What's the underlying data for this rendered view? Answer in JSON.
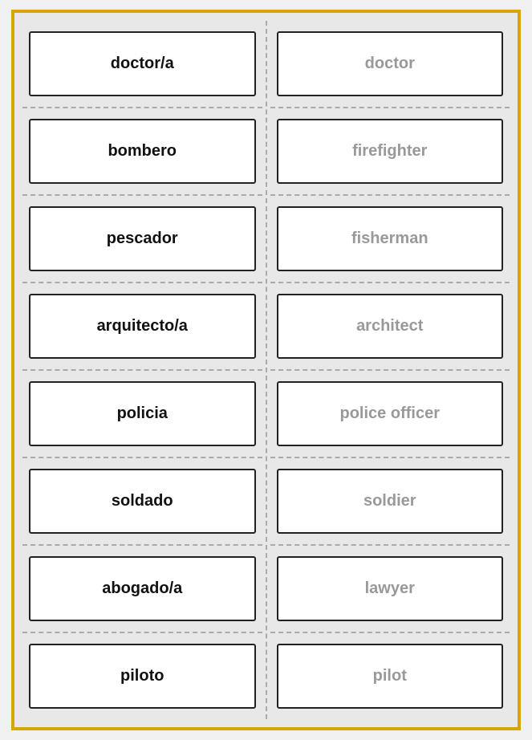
{
  "rows": [
    {
      "spanish": "doctor/a",
      "english": "doctor"
    },
    {
      "spanish": "bombero",
      "english": "firefighter"
    },
    {
      "spanish": "pescador",
      "english": "fisherman"
    },
    {
      "spanish": "arquitecto/a",
      "english": "architect"
    },
    {
      "spanish": "policia",
      "english": "police officer"
    },
    {
      "spanish": "soldado",
      "english": "soldier"
    },
    {
      "spanish": "abogado/a",
      "english": "lawyer"
    },
    {
      "spanish": "piloto",
      "english": "pilot"
    }
  ]
}
